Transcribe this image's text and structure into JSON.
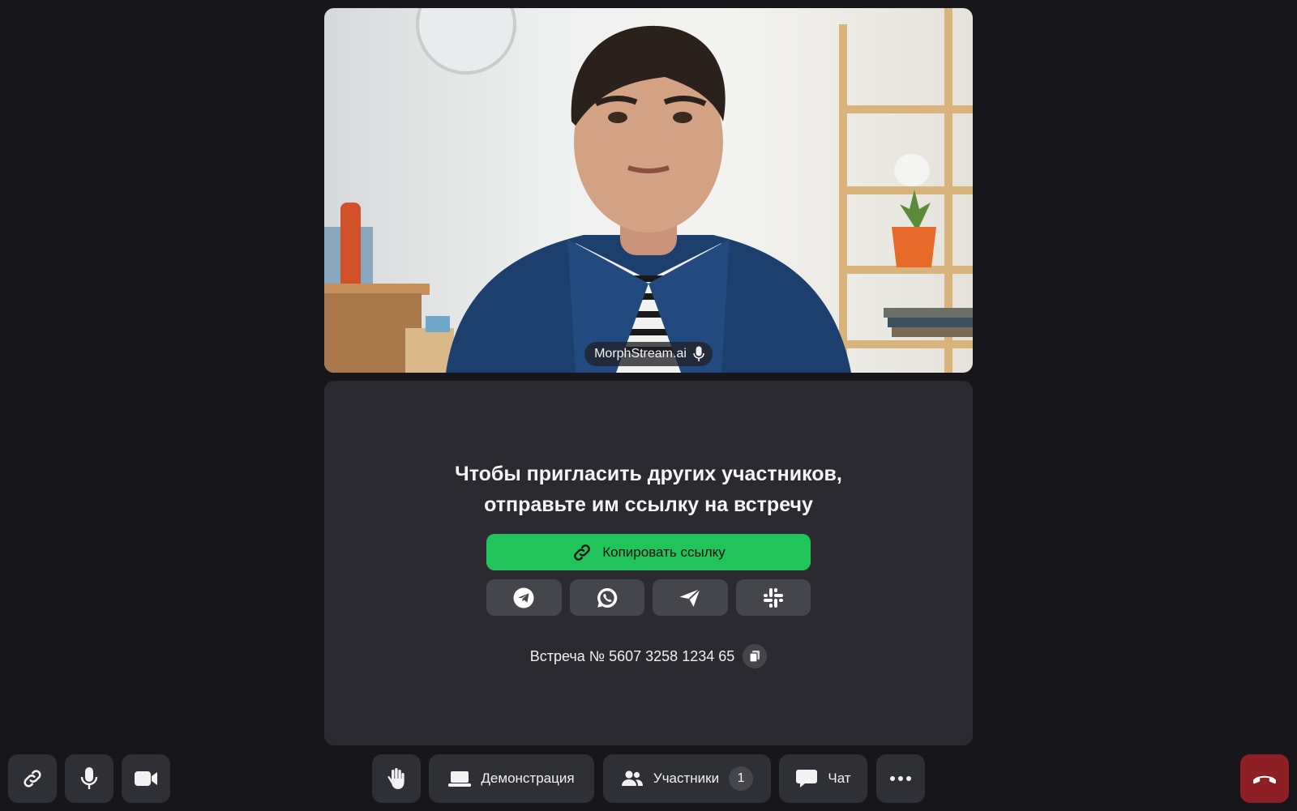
{
  "video": {
    "participant_name": "MorphStream.ai",
    "mic_icon": "microphone-icon"
  },
  "invite": {
    "title_line1": "Чтобы пригласить других участников,",
    "title_line2": "отправьте им ссылку на встречу",
    "copy_link_label": "Копировать ссылку",
    "share_targets": [
      "telegram-icon",
      "whatsapp-icon",
      "send-icon",
      "slack-icon"
    ],
    "meeting_label": "Встреча № 5607 3258 1234 65"
  },
  "toolbar": {
    "left": [
      "link-icon",
      "microphone-icon",
      "camera-icon"
    ],
    "raise_hand_icon": "raise-hand-icon",
    "screen_share_label": "Демонстрация",
    "participants_label": "Участники",
    "participants_count": "1",
    "chat_label": "Чат",
    "more_icon": "more-icon",
    "end_call_icon": "end-call-icon"
  },
  "colors": {
    "background": "#16161b",
    "panel": "#2a2a30",
    "button": "#2f2f36",
    "accent_green": "#21c45b",
    "end_call": "#8e1f24"
  }
}
